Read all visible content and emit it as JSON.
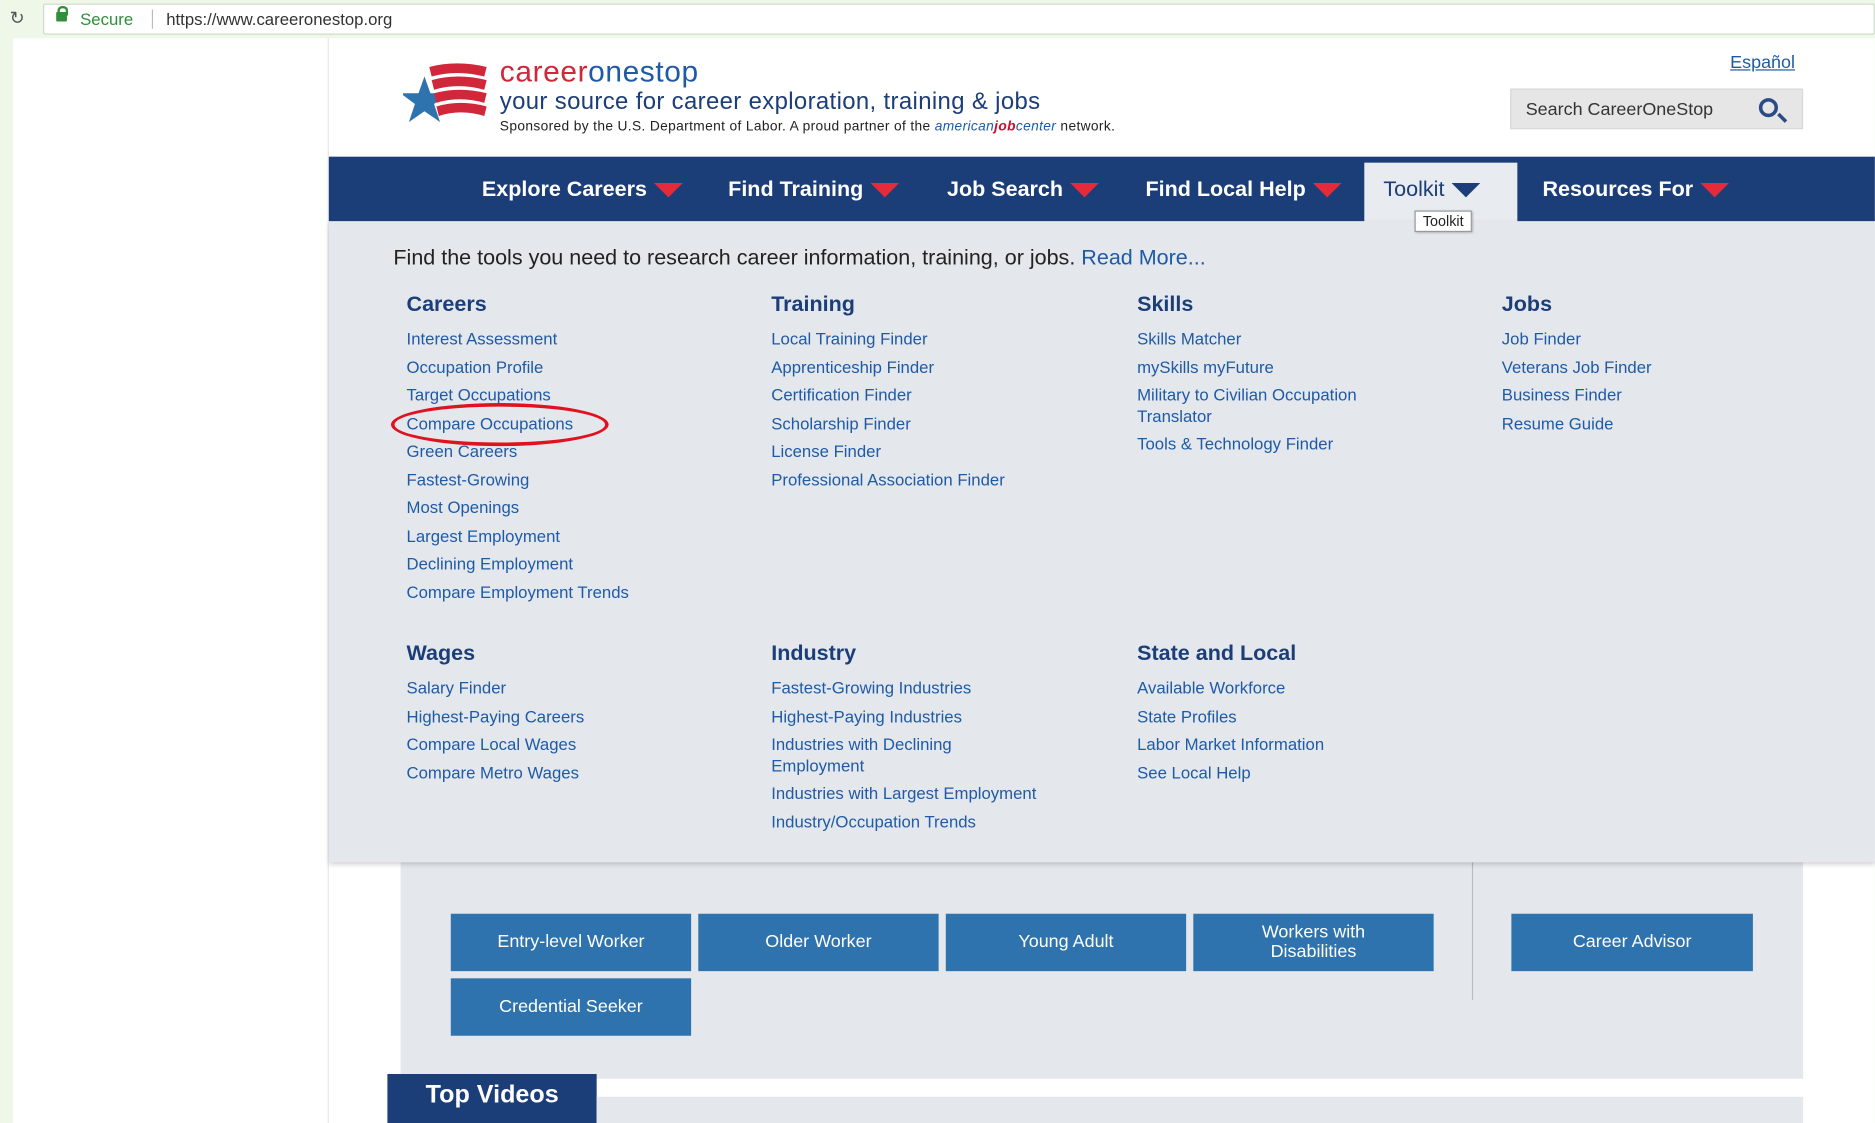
{
  "browser": {
    "secure_label": "Secure",
    "url": "https://www.careeronestop.org"
  },
  "header": {
    "logo_name_part1": "career",
    "logo_name_part2": "onestop",
    "tagline": "your source for career exploration, training & jobs",
    "sponsor_text": "Sponsored by the U.S. Department of Labor. A proud partner of the",
    "sponsor_ajc_1": "american",
    "sponsor_ajc_2": "job",
    "sponsor_ajc_3": "center",
    "sponsor_end": "network.",
    "language_link": "Español",
    "search_placeholder": "Search CareerOneStop"
  },
  "nav": {
    "items": [
      "Explore Careers",
      "Find Training",
      "Job Search",
      "Find Local Help",
      "Toolkit",
      "Resources For"
    ],
    "active": "Toolkit",
    "tooltip": "Toolkit"
  },
  "toolkit": {
    "intro": "Find the tools you need to research career information, training, or jobs.",
    "read_more": "Read More...",
    "sections": [
      {
        "title": "Careers",
        "links": [
          "Interest Assessment",
          "Occupation Profile",
          "Target Occupations",
          "Compare Occupations",
          "Green Careers",
          "Fastest-Growing",
          "Most Openings",
          "Largest Employment",
          "Declining Employment",
          "Compare Employment Trends"
        ]
      },
      {
        "title": "Training",
        "links": [
          "Local Training Finder",
          "Apprenticeship Finder",
          "Certification Finder",
          "Scholarship Finder",
          "License Finder",
          "Professional Association Finder"
        ]
      },
      {
        "title": "Skills",
        "links": [
          "Skills Matcher",
          "mySkills myFuture",
          "Military to Civilian Occupation Translator",
          "Tools & Technology Finder"
        ]
      },
      {
        "title": "Jobs",
        "links": [
          "Job Finder",
          "Veterans Job Finder",
          "Business Finder",
          "Resume Guide"
        ]
      },
      {
        "title": "Wages",
        "links": [
          "Salary Finder",
          "Highest-Paying Careers",
          "Compare Local Wages",
          "Compare Metro Wages"
        ]
      },
      {
        "title": "Industry",
        "links": [
          "Fastest-Growing Industries",
          "Highest-Paying Industries",
          "Industries with Declining Employment",
          "Industries with Largest Employment",
          "Industry/Occupation Trends"
        ]
      },
      {
        "title": "State and Local",
        "links": [
          "Available Workforce",
          "State Profiles",
          "Labor Market Information",
          "See Local Help"
        ]
      }
    ]
  },
  "tiles": [
    "Entry-level Worker",
    "Older Worker",
    "Young Adult",
    "Workers with Disabilities",
    "Career Advisor",
    "Credential Seeker"
  ],
  "top_videos": "Top Videos",
  "colors": {
    "navy": "#1c3e78",
    "accent_red": "#e52a3a",
    "link_blue": "#1f5aa6",
    "tile_blue": "#2e73ad"
  }
}
